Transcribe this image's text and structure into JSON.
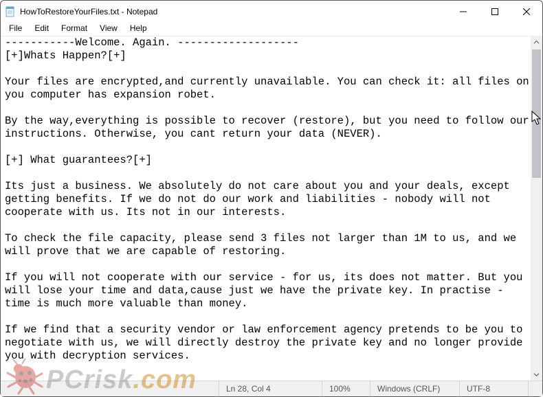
{
  "window": {
    "title": "HowToRestoreYourFiles.txt - Notepad"
  },
  "menu": {
    "file": "File",
    "edit": "Edit",
    "format": "Format",
    "view": "View",
    "help": "Help"
  },
  "editor": {
    "text": "-----------Welcome. Again. -------------------\n[+]Whats Happen?[+]\n\nYour files are encrypted,and currently unavailable. You can check it: all files on you computer has expansion robet.\n\nBy the way,everything is possible to recover (restore), but you need to follow our instructions. Otherwise, you cant return your data (NEVER).\n\n[+] What guarantees?[+]\n\nIts just a business. We absolutely do not care about you and your deals, except getting benefits. If we do not do our work and liabilities - nobody will not cooperate with us. Its not in our interests.\n\nTo check the file capacity, please send 3 files not larger than 1M to us, and we will prove that we are capable of restoring.\n\nIf you will not cooperate with our service - for us, its does not matter. But you will lose your time and data,cause just we have the private key. In practise - time is much more valuable than money.\n\nIf we find that a security vendor or law enforcement agency pretends to be you to negotiate with us, we will directly destroy the private key and no longer provide you with decryption services."
  },
  "status": {
    "caret": "Ln 28, Col 4",
    "zoom": "100%",
    "eol": "Windows (CRLF)",
    "encoding": "UTF-8"
  },
  "watermark": {
    "text_a": "PCrisk",
    "text_b": ".com"
  }
}
